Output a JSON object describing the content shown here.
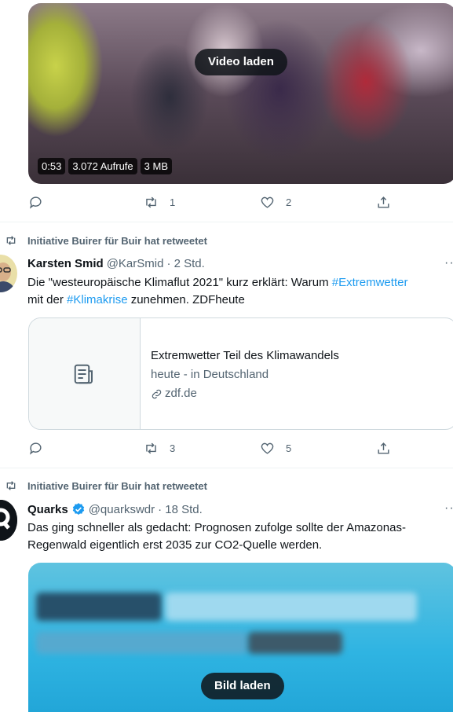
{
  "video": {
    "load_label": "Video laden",
    "duration": "0:53",
    "views": "3.072 Aufrufe",
    "size": "3 MB"
  },
  "tweet1_actions": {
    "retweets": "1",
    "likes": "2"
  },
  "tweet2": {
    "retweeted_by": "Initiative Buirer für Buir hat retweetet",
    "name": "Karsten Smid",
    "handle": "@KarSmid",
    "time": "· 2 Std.",
    "text_a": "Die \"westeuropäische Klimaflut 2021\" kurz erklärt: Warum ",
    "hashtag1": "#Extremwetter",
    "text_b": "mit der ",
    "hashtag2": "#Klimakrise",
    "text_c": " zunehmen. ZDFheute",
    "card": {
      "title": "Extremwetter Teil des Klimawandels",
      "description": "heute - in Deutschland",
      "domain": "zdf.de"
    },
    "actions": {
      "retweets": "3",
      "likes": "5"
    }
  },
  "tweet3": {
    "retweeted_by": "Initiative Buirer für Buir hat retweetet",
    "name": "Quarks",
    "handle": "@quarkswdr",
    "time": "· 18 Std.",
    "text": "Das ging schneller als gedacht: Prognosen zufolge sollte der Amazonas-Regenwald eigentlich erst 2035 zur CO2-Quelle werden.",
    "image_label": "Bild laden"
  },
  "colors": {
    "accent": "#1d9bf0",
    "text": "#0f1419",
    "muted": "#536471",
    "border": "#cfd9de"
  },
  "icons": [
    "reply-icon",
    "retweet-icon",
    "like-icon",
    "share-icon",
    "verified-icon",
    "article-icon",
    "link-icon",
    "more-icon"
  ]
}
